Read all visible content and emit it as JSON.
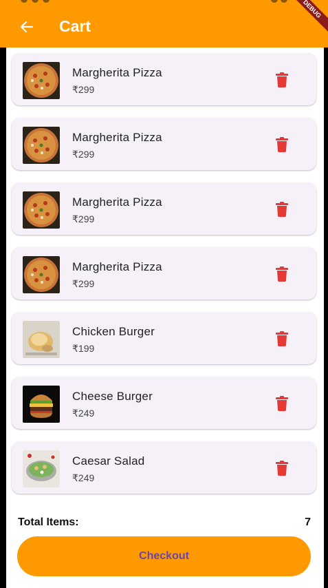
{
  "appbar": {
    "title": "Cart",
    "debug_label": "DEBUG"
  },
  "items": [
    {
      "name": "Margherita Pizza",
      "price": "₹299",
      "image": "pizza"
    },
    {
      "name": "Margherita Pizza",
      "price": "₹299",
      "image": "pizza"
    },
    {
      "name": "Margherita Pizza",
      "price": "₹299",
      "image": "pizza"
    },
    {
      "name": "Margherita Pizza",
      "price": "₹299",
      "image": "pizza"
    },
    {
      "name": "Chicken Burger",
      "price": "₹199",
      "image": "chicken-burger"
    },
    {
      "name": "Cheese Burger",
      "price": "₹249",
      "image": "cheese-burger"
    },
    {
      "name": "Caesar Salad",
      "price": "₹249",
      "image": "caesar-salad"
    }
  ],
  "footer": {
    "total_label": "Total Items:",
    "total_value": "7",
    "checkout_label": "Checkout"
  },
  "colors": {
    "primary": "#FF9900",
    "card": "#F6F1F8",
    "delete": "#E53935",
    "checkout_text": "#6B45A8"
  },
  "icons": {
    "back": "arrow-back-icon",
    "delete": "trash-icon"
  }
}
